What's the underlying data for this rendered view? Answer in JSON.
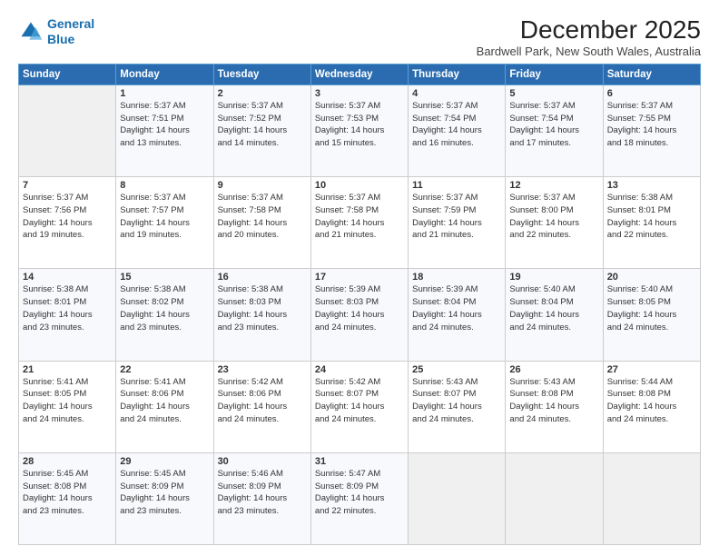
{
  "header": {
    "logo_line1": "General",
    "logo_line2": "Blue",
    "main_title": "December 2025",
    "subtitle": "Bardwell Park, New South Wales, Australia"
  },
  "days_of_week": [
    "Sunday",
    "Monday",
    "Tuesday",
    "Wednesday",
    "Thursday",
    "Friday",
    "Saturday"
  ],
  "weeks": [
    [
      {
        "day": "",
        "info": ""
      },
      {
        "day": "1",
        "info": "Sunrise: 5:37 AM\nSunset: 7:51 PM\nDaylight: 14 hours\nand 13 minutes."
      },
      {
        "day": "2",
        "info": "Sunrise: 5:37 AM\nSunset: 7:52 PM\nDaylight: 14 hours\nand 14 minutes."
      },
      {
        "day": "3",
        "info": "Sunrise: 5:37 AM\nSunset: 7:53 PM\nDaylight: 14 hours\nand 15 minutes."
      },
      {
        "day": "4",
        "info": "Sunrise: 5:37 AM\nSunset: 7:54 PM\nDaylight: 14 hours\nand 16 minutes."
      },
      {
        "day": "5",
        "info": "Sunrise: 5:37 AM\nSunset: 7:54 PM\nDaylight: 14 hours\nand 17 minutes."
      },
      {
        "day": "6",
        "info": "Sunrise: 5:37 AM\nSunset: 7:55 PM\nDaylight: 14 hours\nand 18 minutes."
      }
    ],
    [
      {
        "day": "7",
        "info": "Sunrise: 5:37 AM\nSunset: 7:56 PM\nDaylight: 14 hours\nand 19 minutes."
      },
      {
        "day": "8",
        "info": "Sunrise: 5:37 AM\nSunset: 7:57 PM\nDaylight: 14 hours\nand 19 minutes."
      },
      {
        "day": "9",
        "info": "Sunrise: 5:37 AM\nSunset: 7:58 PM\nDaylight: 14 hours\nand 20 minutes."
      },
      {
        "day": "10",
        "info": "Sunrise: 5:37 AM\nSunset: 7:58 PM\nDaylight: 14 hours\nand 21 minutes."
      },
      {
        "day": "11",
        "info": "Sunrise: 5:37 AM\nSunset: 7:59 PM\nDaylight: 14 hours\nand 21 minutes."
      },
      {
        "day": "12",
        "info": "Sunrise: 5:37 AM\nSunset: 8:00 PM\nDaylight: 14 hours\nand 22 minutes."
      },
      {
        "day": "13",
        "info": "Sunrise: 5:38 AM\nSunset: 8:01 PM\nDaylight: 14 hours\nand 22 minutes."
      }
    ],
    [
      {
        "day": "14",
        "info": "Sunrise: 5:38 AM\nSunset: 8:01 PM\nDaylight: 14 hours\nand 23 minutes."
      },
      {
        "day": "15",
        "info": "Sunrise: 5:38 AM\nSunset: 8:02 PM\nDaylight: 14 hours\nand 23 minutes."
      },
      {
        "day": "16",
        "info": "Sunrise: 5:38 AM\nSunset: 8:03 PM\nDaylight: 14 hours\nand 23 minutes."
      },
      {
        "day": "17",
        "info": "Sunrise: 5:39 AM\nSunset: 8:03 PM\nDaylight: 14 hours\nand 24 minutes."
      },
      {
        "day": "18",
        "info": "Sunrise: 5:39 AM\nSunset: 8:04 PM\nDaylight: 14 hours\nand 24 minutes."
      },
      {
        "day": "19",
        "info": "Sunrise: 5:40 AM\nSunset: 8:04 PM\nDaylight: 14 hours\nand 24 minutes."
      },
      {
        "day": "20",
        "info": "Sunrise: 5:40 AM\nSunset: 8:05 PM\nDaylight: 14 hours\nand 24 minutes."
      }
    ],
    [
      {
        "day": "21",
        "info": "Sunrise: 5:41 AM\nSunset: 8:05 PM\nDaylight: 14 hours\nand 24 minutes."
      },
      {
        "day": "22",
        "info": "Sunrise: 5:41 AM\nSunset: 8:06 PM\nDaylight: 14 hours\nand 24 minutes."
      },
      {
        "day": "23",
        "info": "Sunrise: 5:42 AM\nSunset: 8:06 PM\nDaylight: 14 hours\nand 24 minutes."
      },
      {
        "day": "24",
        "info": "Sunrise: 5:42 AM\nSunset: 8:07 PM\nDaylight: 14 hours\nand 24 minutes."
      },
      {
        "day": "25",
        "info": "Sunrise: 5:43 AM\nSunset: 8:07 PM\nDaylight: 14 hours\nand 24 minutes."
      },
      {
        "day": "26",
        "info": "Sunrise: 5:43 AM\nSunset: 8:08 PM\nDaylight: 14 hours\nand 24 minutes."
      },
      {
        "day": "27",
        "info": "Sunrise: 5:44 AM\nSunset: 8:08 PM\nDaylight: 14 hours\nand 24 minutes."
      }
    ],
    [
      {
        "day": "28",
        "info": "Sunrise: 5:45 AM\nSunset: 8:08 PM\nDaylight: 14 hours\nand 23 minutes."
      },
      {
        "day": "29",
        "info": "Sunrise: 5:45 AM\nSunset: 8:09 PM\nDaylight: 14 hours\nand 23 minutes."
      },
      {
        "day": "30",
        "info": "Sunrise: 5:46 AM\nSunset: 8:09 PM\nDaylight: 14 hours\nand 23 minutes."
      },
      {
        "day": "31",
        "info": "Sunrise: 5:47 AM\nSunset: 8:09 PM\nDaylight: 14 hours\nand 22 minutes."
      },
      {
        "day": "",
        "info": ""
      },
      {
        "day": "",
        "info": ""
      },
      {
        "day": "",
        "info": ""
      }
    ]
  ]
}
